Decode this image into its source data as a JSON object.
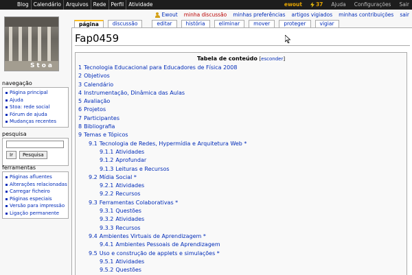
{
  "topbar": {
    "left": [
      "Blog",
      "Calendário",
      "Arquivos",
      "Rede",
      "Perfil",
      "Atividade"
    ],
    "user": "ewout",
    "count": "37",
    "right": [
      "Ajuda",
      "Configurações",
      "Sair"
    ]
  },
  "logo": {
    "text": "Stoa"
  },
  "personal": {
    "user": "Ewout",
    "discussion": "minha discussão",
    "prefs": "minhas preferências",
    "watched": "artigos vigiados",
    "contribs": "minhas contribuições",
    "logout": "sair"
  },
  "tabs": [
    "página",
    "discussão",
    "editar",
    "história",
    "eliminar",
    "mover",
    "proteger",
    "vigiar"
  ],
  "page": {
    "title": "Fap0459"
  },
  "toc": {
    "title": "Tabela de conteúdo",
    "hide_open": "[",
    "hide": "esconder",
    "hide_close": "]",
    "items": [
      {
        "num": "1",
        "text": "Tecnologia Educacional para Educadores de Física 2008",
        "level": 1
      },
      {
        "num": "2",
        "text": "Objetivos",
        "level": 1
      },
      {
        "num": "3",
        "text": "Calendário",
        "level": 1
      },
      {
        "num": "4",
        "text": "Instrumentação, Dinâmica das Aulas",
        "level": 1
      },
      {
        "num": "5",
        "text": "Avaliação",
        "level": 1
      },
      {
        "num": "6",
        "text": "Projetos",
        "level": 1
      },
      {
        "num": "7",
        "text": "Participantes",
        "level": 1
      },
      {
        "num": "8",
        "text": "Bibliografia",
        "level": 1
      },
      {
        "num": "9",
        "text": "Temas e Tópicos",
        "level": 1
      },
      {
        "num": "9.1",
        "text": "Tecnologia de Redes, Hypermídia e Arquitetura Web *",
        "level": 2
      },
      {
        "num": "9.1.1",
        "text": "Atividades",
        "level": 3
      },
      {
        "num": "9.1.2",
        "text": "Aprofundar",
        "level": 3
      },
      {
        "num": "9.1.3",
        "text": "Leituras e Recursos",
        "level": 3
      },
      {
        "num": "9.2",
        "text": "Mídia Social *",
        "level": 2
      },
      {
        "num": "9.2.1",
        "text": "Atividades",
        "level": 3
      },
      {
        "num": "9.2.2",
        "text": "Recursos",
        "level": 3
      },
      {
        "num": "9.3",
        "text": "Ferramentas Colaborativas *",
        "level": 2
      },
      {
        "num": "9.3.1",
        "text": "Questões",
        "level": 3
      },
      {
        "num": "9.3.2",
        "text": "Atividades",
        "level": 3
      },
      {
        "num": "9.3.3",
        "text": "Recursos",
        "level": 3
      },
      {
        "num": "9.4",
        "text": "Ambientes Virtuais de Aprendizagem *",
        "level": 2
      },
      {
        "num": "9.4.1",
        "text": "Ambientes Pessoais de Aprendizagem",
        "level": 3
      },
      {
        "num": "9.5",
        "text": "Uso e construção de applets e simulações *",
        "level": 2
      },
      {
        "num": "9.5.1",
        "text": "Atividades",
        "level": 3
      },
      {
        "num": "9.5.2",
        "text": "Questões",
        "level": 3
      }
    ]
  },
  "sidebar": {
    "nav_title": "navegação",
    "nav": [
      "Página principal",
      "Ajuda",
      "Stoa: rede social",
      "Fórum de ajuda",
      "Mudanças recentes"
    ],
    "search_title": "pesquisa",
    "search_go": "Ir",
    "search_btn": "Pesquisa",
    "tools_title": "ferramentas",
    "tools": [
      "Páginas afluentes",
      "Alterações relacionadas",
      "Carregar ficheiro",
      "Páginas especiais",
      "Versão para impressão",
      "Ligação permanente"
    ]
  }
}
